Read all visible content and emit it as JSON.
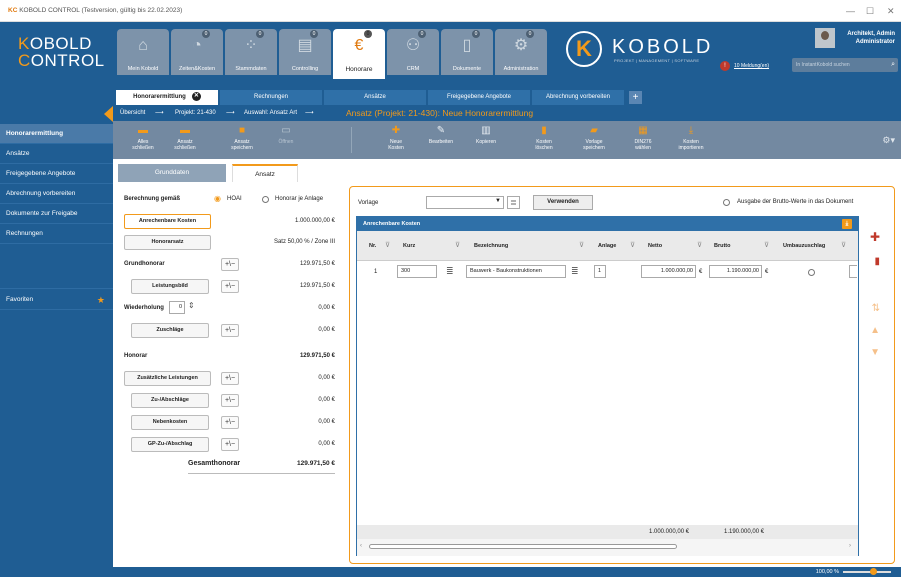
{
  "window": {
    "brand": "KC",
    "title": "KOBOLD CONTROL (Testversion, gültig bis 22.02.2023)",
    "minimize": "—",
    "maximize": "☐",
    "close": "✕"
  },
  "logo": {
    "line1_k": "K",
    "line1_rest": "OBOLD",
    "line2_c": "C",
    "line2_rest": "ONTROL"
  },
  "nav": [
    {
      "label": "Mein Kobold",
      "icon": "home-icon",
      "badge": ""
    },
    {
      "label": "Zeiten&Kosten",
      "icon": "stopwatch-icon",
      "badge": "0"
    },
    {
      "label": "Stammdaten",
      "icon": "people-dots-icon",
      "badge": "0"
    },
    {
      "label": "Controlling",
      "icon": "calculator-icon",
      "badge": "0"
    },
    {
      "label": "Honorare",
      "icon": "coins-euro-icon",
      "badge": "0"
    },
    {
      "label": "CRM",
      "icon": "contacts-icon",
      "badge": "0"
    },
    {
      "label": "Dokumente",
      "icon": "document-icon",
      "badge": "0"
    },
    {
      "label": "Administration",
      "icon": "gears-icon",
      "badge": "0"
    }
  ],
  "brand": {
    "name": "KOBOLD",
    "sub": "PROJEKT | MANAGEMENT | SOFTWARE",
    "messages_count": "!",
    "messages": "10 Meldung(en)"
  },
  "user": {
    "name": "Architekt, Admin",
    "role": "Administrator",
    "search_placeholder": "In InstantKobold suchen"
  },
  "sidebar": {
    "items": [
      "Honorarermittlung",
      "Ansätze",
      "Freigegebene Angebote",
      "Abrechnung vorbereiten",
      "Dokumente zur Freigabe",
      "Rechnungen"
    ],
    "favorites": "Favoriten"
  },
  "tabs": [
    {
      "label": "Honorarermittlung",
      "close": "✕"
    },
    {
      "label": "Rechnungen"
    },
    {
      "label": "Ansätze"
    },
    {
      "label": "Freigegebene Angebote"
    },
    {
      "label": "Abrechnung vorbereiten"
    }
  ],
  "tab_add": "+",
  "breadcrumb": {
    "a": "Übersicht",
    "arrow": "⟶",
    "b": "Projekt: 21-430",
    "c": "Auswahl: Ansatz Art",
    "title": "Ansatz (Projekt: 21-430): Neue Honorarermittlung"
  },
  "toolbar": [
    {
      "l1": "Alles",
      "l2": "schließen",
      "icon": "folder-icon"
    },
    {
      "l1": "Ansatz",
      "l2": "schließen",
      "icon": "folder-icon"
    },
    {
      "l1": "Ansatz",
      "l2": "speichern",
      "icon": "save-icon"
    },
    {
      "l1": "Öffnen",
      "l2": "",
      "icon": "open-icon"
    },
    {
      "l1": "Neue",
      "l2": "Kosten",
      "icon": "plus-icon"
    },
    {
      "l1": "Bearbeiten",
      "l2": "",
      "icon": "edit-icon"
    },
    {
      "l1": "Kopieren",
      "l2": "",
      "icon": "copy-icon"
    },
    {
      "l1": "Kosten",
      "l2": "löschen",
      "icon": "trash-icon"
    },
    {
      "l1": "Vorlage",
      "l2": "speichern",
      "icon": "template-save-icon"
    },
    {
      "l1": "DIN276",
      "l2": "wählen",
      "icon": "din-icon"
    },
    {
      "l1": "Kosten",
      "l2": "importieren",
      "icon": "import-icon"
    }
  ],
  "subtabs": {
    "a": "Grunddaten",
    "b": "Ansatz"
  },
  "left": {
    "berechnung_label": "Berechnung gemäß",
    "opt1": "HOAI",
    "opt2": "Honorar je Anlage",
    "anrechenbare_btn": "Anrechenbare Kosten",
    "anrechenbare_val": "1.000.000,00 €",
    "honorarsatz_btn": "Honorarsatz",
    "honorarsatz_val": "Satz 50,00 % / Zone III",
    "grundhonorar_label": "Grundhonorar",
    "grundhonorar_val": "129.971,50 €",
    "leistungsbild_btn": "Leistungsbild",
    "leistungsbild_val": "129.971,50 €",
    "wiederholung_label": "Wiederholung",
    "wiederholung_val": "0",
    "wiederholung_amount": "0,00 €",
    "zuschlaege_btn": "Zuschläge",
    "zuschlaege_val": "0,00 €",
    "honorar_label": "Honorar",
    "honorar_val": "129.971,50 €",
    "zusaetzliche_btn": "Zusätzliche Leistungen",
    "zusaetzliche_val": "0,00 €",
    "zuabschlaege_btn": "Zu-/Abschläge",
    "zuabschlaege_val": "0,00 €",
    "nebenkosten_btn": "Nebenkosten",
    "nebenkosten_val": "0,00 €",
    "gp_btn": "GP-Zu-/Abschlag",
    "gp_val": "0,00 €",
    "gesamt_label": "Gesamthonorar",
    "gesamt_val": "129.971,50 €",
    "pm": "+\\−"
  },
  "right": {
    "vorlage_label": "Vorlage",
    "vorlage_value": "",
    "verwenden_btn": "Verwenden",
    "brutto_option": "Ausgabe der Brutto-Werte in das Dokument",
    "grid_title": "Anrechenbare Kosten",
    "columns": [
      "Nr.",
      "Kurz",
      "Bezeichnung",
      "Anlage",
      "Netto",
      "Brutto",
      "Umbauzuschlag"
    ],
    "rows": [
      {
        "nr": "1",
        "kurz": "300",
        "bezeichnung": "Bauwerk - Baukonstruktionen",
        "anlage": "1",
        "netto": "1.000.000,00",
        "brutto": "1.190.000,00",
        "cur": "€"
      }
    ],
    "sum_netto": "1.000.000,00 €",
    "sum_brutto": "1.190.000,00 €"
  },
  "status": {
    "zoom": "100,00 %"
  }
}
